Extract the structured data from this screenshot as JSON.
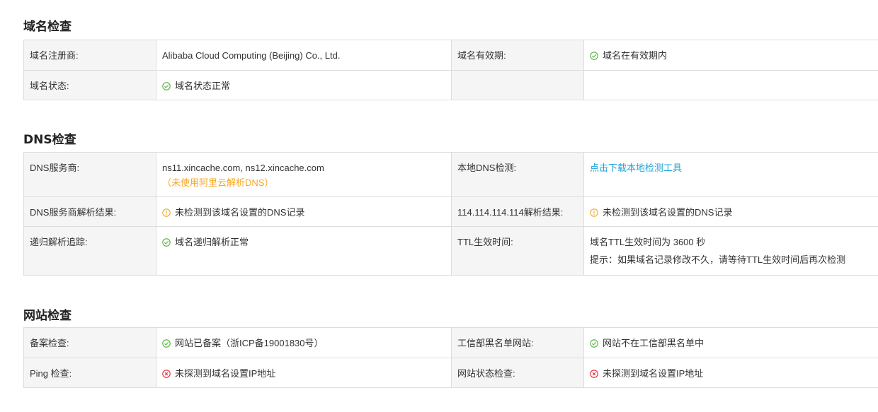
{
  "colors": {
    "ok": "#52b13c",
    "warn": "#f5a623",
    "error": "#e8232c",
    "link": "#1ca4d8",
    "label_bg": "#f5f5f5",
    "border": "#dddddd"
  },
  "domain_check": {
    "title": "域名检查",
    "registrar_label": "域名注册商:",
    "registrar_value": "Alibaba Cloud Computing (Beijing) Co., Ltd.",
    "validity_label": "域名有效期:",
    "validity_value": "域名在有效期内",
    "validity_icon": "check-circle-icon",
    "status_label": "域名状态:",
    "status_value": "域名状态正常",
    "status_icon": "check-circle-icon"
  },
  "dns_check": {
    "title": "DNS检查",
    "provider_label": "DNS服务商:",
    "provider_value": "ns11.xincache.com, ns12.xincache.com",
    "provider_note": "（未使用阿里云解析DNS）",
    "local_label": "本地DNS检测:",
    "local_link": "点击下载本地检测工具",
    "provider_result_label": "DNS服务商解析结果:",
    "provider_result_value": "未检测到该域名设置的DNS记录",
    "provider_result_icon": "warning-circle-icon",
    "public_result_label": "114.114.114.114解析结果:",
    "public_result_value": "未检测到该域名设置的DNS记录",
    "public_result_icon": "warning-circle-icon",
    "recursive_label": "递归解析追踪:",
    "recursive_value": "域名递归解析正常",
    "recursive_icon": "check-circle-icon",
    "ttl_label": "TTL生效时间:",
    "ttl_value": "域名TTL生效时间为 3600 秒",
    "ttl_hint": "提示：如果域名记录修改不久，请等待TTL生效时间后再次检测"
  },
  "site_check": {
    "title": "网站检查",
    "icp_label": "备案检查:",
    "icp_value": "网站已备案（浙ICP备19001830号）",
    "icp_icon": "check-circle-icon",
    "blacklist_label": "工信部黑名单网站:",
    "blacklist_value": "网站不在工信部黑名单中",
    "blacklist_icon": "check-circle-icon",
    "ping_label": "Ping 检查:",
    "ping_value": "未探测到域名设置IP地址",
    "ping_icon": "error-circle-icon",
    "site_status_label": "网站状态检查:",
    "site_status_value": "未探测到域名设置IP地址",
    "site_status_icon": "error-circle-icon"
  }
}
